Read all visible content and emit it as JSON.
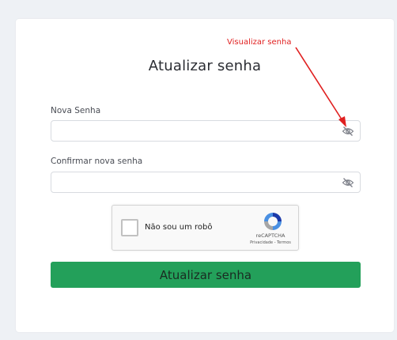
{
  "form": {
    "title": "Atualizar senha",
    "new_password": {
      "label": "Nova Senha",
      "value": "",
      "toggle_icon": "eye-off-icon"
    },
    "confirm_password": {
      "label": "Confirmar nova senha",
      "value": "",
      "toggle_icon": "eye-off-icon"
    },
    "recaptcha": {
      "label": "Não sou um robô",
      "brand": "reCAPTCHA",
      "links": "Privacidade - Termos",
      "checked": false
    },
    "submit_label": "Atualizar senha"
  },
  "annotation": {
    "text": "Visualizar senha",
    "color": "#e02020"
  },
  "colors": {
    "submit_background": "#23a05a",
    "page_background": "#eef1f5"
  }
}
